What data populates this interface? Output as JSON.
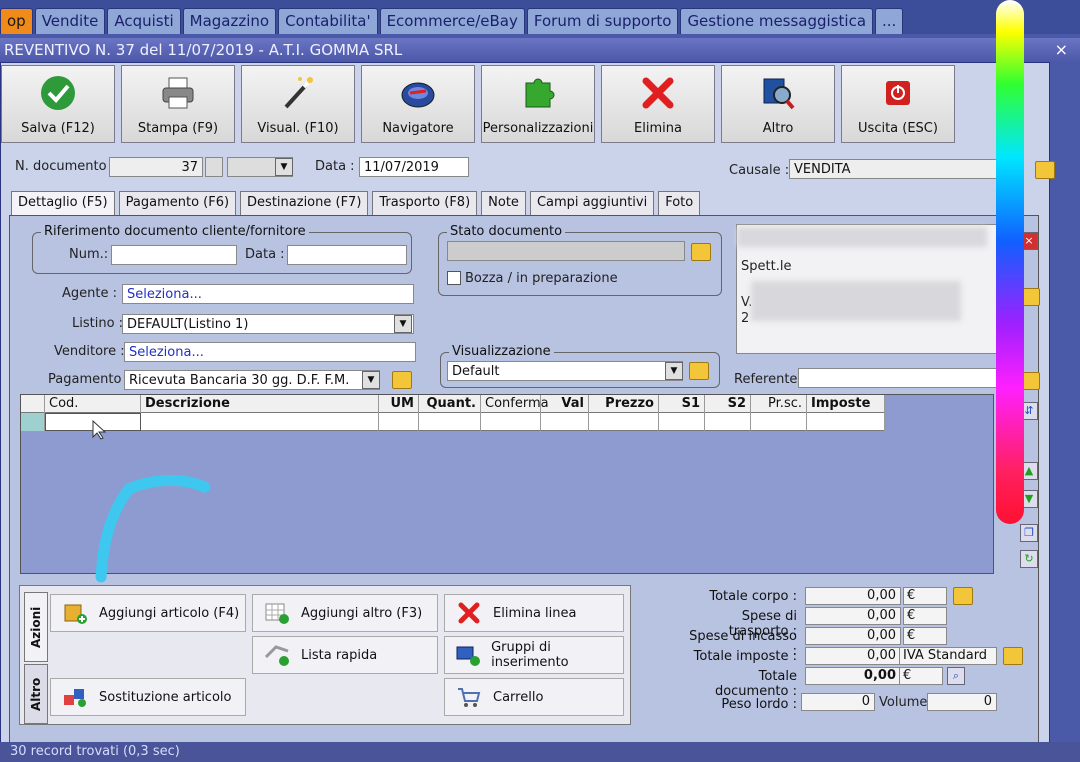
{
  "top_tabs": [
    "op",
    "Vendite",
    "Acquisti",
    "Magazzino",
    "Contabilita'",
    "Ecommerce/eBay",
    "Forum di supporto",
    "Gestione messaggistica",
    "..."
  ],
  "window_title": "REVENTIVO N. 37 del 11/07/2019 - A.T.I. GOMMA SRL",
  "close_glyph": "×",
  "toolbar": [
    {
      "label": "Salva (F12)",
      "icon": "check-icon",
      "color": "#2f9a3a"
    },
    {
      "label": "Stampa (F9)",
      "icon": "printer-icon",
      "color": "#666666"
    },
    {
      "label": "Visual. (F10)",
      "icon": "magic-wand-icon",
      "color": "#333333"
    },
    {
      "label": "Navigatore",
      "icon": "compass-icon",
      "color": "#2a4aa0"
    },
    {
      "label": "Personalizzazioni",
      "icon": "puzzle-icon",
      "color": "#36a830"
    },
    {
      "label": "Elimina",
      "icon": "delete-x-icon",
      "color": "#e02020"
    },
    {
      "label": "Altro",
      "icon": "search-doc-icon",
      "color": "#2050a0"
    },
    {
      "label": "Uscita (ESC)",
      "icon": "power-icon",
      "color": "#d02020"
    }
  ],
  "header": {
    "doc_num_label": "N. documento :",
    "doc_num": "37",
    "data_label": "Data :",
    "data": "11/07/2019",
    "causale_label": "Causale :",
    "causale": "VENDITA"
  },
  "subtabs": [
    "Dettaglio (F5)",
    "Pagamento (F6)",
    "Destinazione (F7)",
    "Trasporto (F8)",
    "Note",
    "Campi aggiuntivi",
    "Foto"
  ],
  "riferimento": {
    "title": "Riferimento documento cliente/fornitore",
    "num_label": "Num.:",
    "data_label": "Data :"
  },
  "stato": {
    "title": "Stato documento",
    "bozza": "Bozza / in preparazione"
  },
  "fields": {
    "agente_label": "Agente :",
    "agente": "Seleziona...",
    "listino_label": "Listino :",
    "listino": "DEFAULT(Listino 1)",
    "venditore_label": "Venditore :",
    "venditore": "Seleziona...",
    "pagamento_label": "Pagamento :",
    "pagamento": "Ricevuta Bancaria 30 gg. D.F. F.M."
  },
  "visualizzazione": {
    "title": "Visualizzazione",
    "value": "Default"
  },
  "cliente": {
    "spett": "Spett.le",
    "line2": "V.",
    "line3": "2",
    "referente_label": "Referente"
  },
  "grid_headers": [
    "",
    "Cod.",
    "Descrizione",
    "UM",
    "Quant.",
    "Conferma",
    "Val",
    "Prezzo",
    "S1",
    "S2",
    "Pr.sc.",
    "Imposte"
  ],
  "actions": {
    "tab_azioni": "Azioni",
    "tab_altro": "Altro",
    "buttons": [
      {
        "label": "Aggiungi articolo (F4)",
        "icon": "box-add-icon"
      },
      {
        "label": "Aggiungi altro (F3)",
        "icon": "grid-add-icon"
      },
      {
        "label": "Elimina linea",
        "icon": "delete-x-icon"
      },
      {
        "label": "Lista rapida",
        "icon": "list-add-icon"
      },
      {
        "label": "Gruppi di inserimento",
        "icon": "group-add-icon"
      },
      {
        "label": "Sostituzione articolo",
        "icon": "swap-icon"
      },
      {
        "label": "Carrello",
        "icon": "cart-icon"
      }
    ]
  },
  "totals": {
    "corpo_label": "Totale corpo :",
    "corpo": "0,00",
    "corpo_cur": "€",
    "trasporto_label": "Spese di trasporto :",
    "trasporto": "0,00",
    "trasporto_cur": "€",
    "incasso_label": "Spese di incasso :",
    "incasso": "0,00",
    "incasso_cur": "€",
    "imposte_label": "Totale imposte :",
    "imposte": "0,00",
    "imposte_cur": "IVA Standard",
    "documento_label": "Totale documento :",
    "documento": "0,00",
    "documento_cur": "€",
    "peso_label": "Peso lordo :",
    "peso": "0",
    "volume_label": "Volume :",
    "volume": "0"
  },
  "status_text": "30 record trovati (0,3 sec)"
}
